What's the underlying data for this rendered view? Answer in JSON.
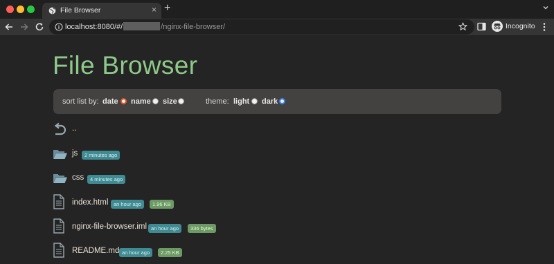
{
  "browser": {
    "tab_title": "File Browser",
    "tab_close": "×",
    "new_tab": "+",
    "url_host": "localhost:8080/#/",
    "url_path": "/nginx-file-browser/",
    "profile_label": "Incognito"
  },
  "page": {
    "title": "File Browser",
    "options": {
      "sort_label": "sort list by:",
      "sort_options": [
        "date",
        "name",
        "size"
      ],
      "sort_selected": "date",
      "theme_label": "theme:",
      "theme_options": [
        "light",
        "dark"
      ],
      "theme_selected": "dark"
    },
    "parent_dir_label": "..",
    "entries": [
      {
        "name": "js",
        "type": "folder",
        "modified": "2 minutes ago",
        "size": ""
      },
      {
        "name": "css",
        "type": "folder",
        "modified": "4 minutes ago",
        "size": ""
      },
      {
        "name": "index.html",
        "type": "file",
        "modified": "an hour ago",
        "size": "1.96 KB"
      },
      {
        "name": "nginx-file-browser.iml",
        "type": "file",
        "modified": "an hour ago",
        "size": "336 bytes"
      },
      {
        "name": "README.md",
        "type": "file",
        "modified": "an hour ago",
        "size": "2.25 KB"
      }
    ]
  },
  "colors": {
    "title_green": "#8fc98a",
    "time_badge": "#3f8b93",
    "size_badge": "#6b9a62",
    "sort_radio_accent": "#e0582a",
    "theme_radio_accent": "#3b82f6"
  },
  "icons": {
    "parent_dir": "undo-arrow-icon",
    "folder": "folder-icon",
    "file": "file-icon"
  }
}
